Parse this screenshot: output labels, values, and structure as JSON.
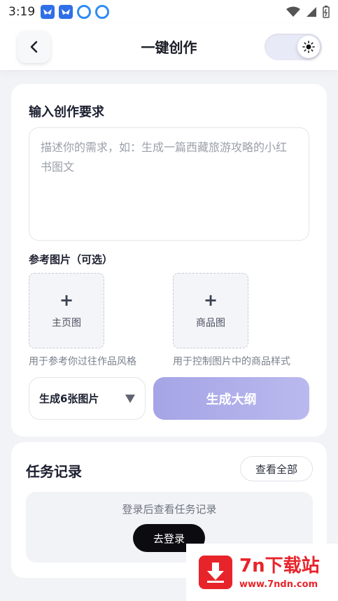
{
  "status_bar": {
    "time": "3:19"
  },
  "header": {
    "title": "一键创作"
  },
  "create": {
    "section_title": "输入创作要求",
    "prompt_placeholder": "描述你的需求，如：生成一篇西藏旅游攻略的小红书图文",
    "ref_title": "参考图片（可选）",
    "upload_main_label": "主页图",
    "upload_main_hint": "用于参考你过往作品风格",
    "upload_product_label": "商品图",
    "upload_product_hint": "用于控制图片中的商品样式",
    "count_select_value": "生成6张图片",
    "generate_button": "生成大纲"
  },
  "tasks": {
    "title": "任务记录",
    "view_all": "查看全部",
    "empty_text": "登录后查看任务记录",
    "login_button": "去登录"
  },
  "watermark": {
    "brand": "7n下载站",
    "url": "www.7ndn.com"
  },
  "colors": {
    "accent": "#a5a4e6",
    "watermark_red": "#e8242b"
  }
}
